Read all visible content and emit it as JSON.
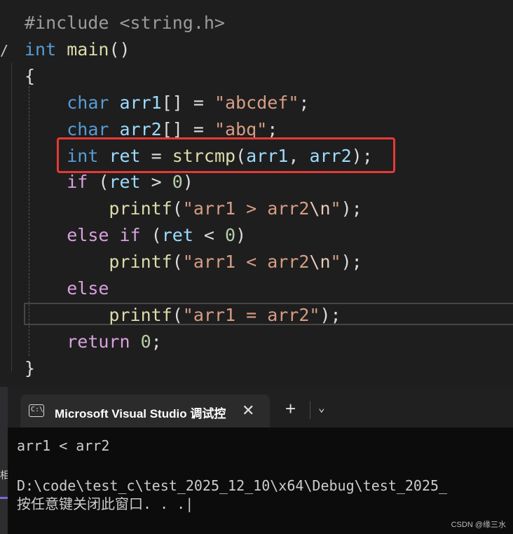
{
  "editor": {
    "lines": [
      [
        {
          "t": "#include <string.h>",
          "c": "pp"
        }
      ],
      [
        {
          "t": "int",
          "c": "kw"
        },
        {
          "t": " "
        },
        {
          "t": "main",
          "c": "fn"
        },
        {
          "t": "()"
        }
      ],
      [
        {
          "t": "{"
        }
      ],
      [
        {
          "t": "    "
        },
        {
          "t": "char",
          "c": "kw"
        },
        {
          "t": " "
        },
        {
          "t": "arr1",
          "c": "var"
        },
        {
          "t": "[] = "
        },
        {
          "t": "\"abcdef\"",
          "c": "str"
        },
        {
          "t": ";"
        }
      ],
      [
        {
          "t": "    "
        },
        {
          "t": "char",
          "c": "kw"
        },
        {
          "t": " "
        },
        {
          "t": "arr2",
          "c": "var"
        },
        {
          "t": "[] = "
        },
        {
          "t": "\"abq\"",
          "c": "str"
        },
        {
          "t": ";"
        }
      ],
      [
        {
          "t": "    "
        },
        {
          "t": "int",
          "c": "kw"
        },
        {
          "t": " "
        },
        {
          "t": "ret",
          "c": "var"
        },
        {
          "t": " = "
        },
        {
          "t": "strcmp",
          "c": "fn"
        },
        {
          "t": "("
        },
        {
          "t": "arr1",
          "c": "var"
        },
        {
          "t": ", "
        },
        {
          "t": "arr2",
          "c": "var"
        },
        {
          "t": ");"
        }
      ],
      [
        {
          "t": "    "
        },
        {
          "t": "if",
          "c": "kw2"
        },
        {
          "t": " ("
        },
        {
          "t": "ret",
          "c": "var"
        },
        {
          "t": " > "
        },
        {
          "t": "0",
          "c": "num"
        },
        {
          "t": ")"
        }
      ],
      [
        {
          "t": "        "
        },
        {
          "t": "printf",
          "c": "fn"
        },
        {
          "t": "("
        },
        {
          "t": "\"arr1 > arr2",
          "c": "str"
        },
        {
          "t": "\\n",
          "c": "esc"
        },
        {
          "t": "\"",
          "c": "str"
        },
        {
          "t": ");"
        }
      ],
      [
        {
          "t": "    "
        },
        {
          "t": "else",
          "c": "kw2"
        },
        {
          "t": " "
        },
        {
          "t": "if",
          "c": "kw2"
        },
        {
          "t": " ("
        },
        {
          "t": "ret",
          "c": "var"
        },
        {
          "t": " < "
        },
        {
          "t": "0",
          "c": "num"
        },
        {
          "t": ")"
        }
      ],
      [
        {
          "t": "        "
        },
        {
          "t": "printf",
          "c": "fn"
        },
        {
          "t": "("
        },
        {
          "t": "\"arr1 < arr2",
          "c": "str"
        },
        {
          "t": "\\n",
          "c": "esc"
        },
        {
          "t": "\"",
          "c": "str"
        },
        {
          "t": ");"
        }
      ],
      [
        {
          "t": "    "
        },
        {
          "t": "else",
          "c": "kw2"
        }
      ],
      [
        {
          "t": "        "
        },
        {
          "t": "printf",
          "c": "fn"
        },
        {
          "t": "("
        },
        {
          "t": "\"arr1 = arr2\"",
          "c": "str"
        },
        {
          "t": ");"
        }
      ],
      [
        {
          "t": "    "
        },
        {
          "t": "return",
          "c": "kw2"
        },
        {
          "t": " "
        },
        {
          "t": "0",
          "c": "num"
        },
        {
          "t": ";"
        }
      ],
      [
        {
          "t": "}"
        }
      ]
    ]
  },
  "console": {
    "tab_title": "Microsoft Visual Studio 调试控",
    "tab_icon_text": "C:\\",
    "close_glyph": "✕",
    "new_tab_glyph": "+",
    "dropdown_glyph": "⌄",
    "output_line1": "arr1 < arr2",
    "output_line2": "D:\\code\\test_c\\test_2025_12_10\\x64\\Debug\\test_2025_",
    "output_line3": "按任意键关闭此窗口. . .|"
  },
  "left_strip_char": "相",
  "watermark": "CSDN @缘三水",
  "colors": {
    "editor_bg": "#1e1e1e",
    "keyword": "#569cd6",
    "control_keyword": "#d8a0df",
    "function": "#dcdcaa",
    "variable": "#9cdcfe",
    "string": "#d69d85",
    "number": "#b5cea8",
    "highlight_box": "#e53935",
    "console_bg": "#0c0c0c"
  }
}
